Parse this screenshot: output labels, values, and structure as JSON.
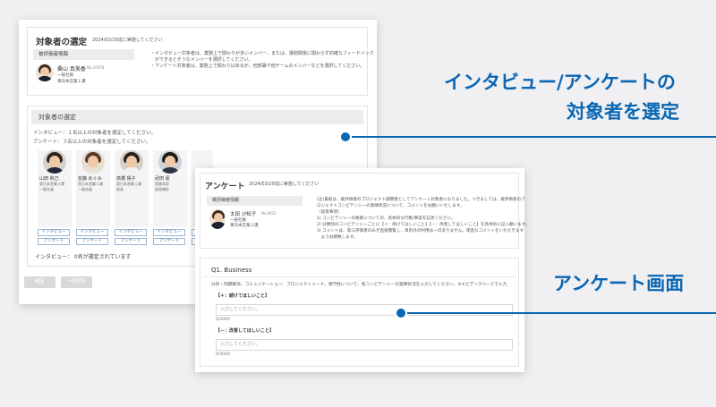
{
  "target_panel": {
    "title": "対象者の選定",
    "deadline": "2024/02/29迄に実施してください",
    "evaluatee_header": "被評価者情報",
    "evaluatee": {
      "name": "桑山 真美香",
      "id": "No.10078",
      "role": "一般社員",
      "dept": "東日本営業１課"
    },
    "instructions": [
      "・インタビュー対象者は、業務上で関わりが多いメンバー、または、援助関係に関わらず的確なフィードバック",
      "　ができるとそうなメンバーを選択してください。",
      "・アンケート対象者は、業務上で関わりはあるが、他部署や他チームのメンバーなどを選択してください。"
    ],
    "select_header": "対象者の選定",
    "interview_note": "インタビュー：１名以上の対象者を選定してください。",
    "survey_note": "アンケート：３名以上の対象者を選定してください。",
    "employees": [
      {
        "name": "山田 和己",
        "dept": "東日本営業２課",
        "role": "一般社員"
      },
      {
        "name": "佐藤 めぐみ",
        "dept": "西日本営業１課",
        "role": "一般社員"
      },
      {
        "name": "高橋 晴子",
        "dept": "東日本営業１課",
        "role": "係長"
      },
      {
        "name": "武田 豪",
        "dept": "営業本部",
        "role": "部長補佐"
      }
    ],
    "interview_btn": "インタビュー",
    "survey_btn": "アンケート",
    "selected_status": "インタビュー： 0名が選定されています",
    "confirm_btn": "確定",
    "save_btn": "一時保存"
  },
  "survey_panel": {
    "title": "アンケート",
    "deadline": "2024/03/29迄に実施してください",
    "evaluatee_header": "被評価者情報",
    "evaluatee": {
      "name": "太田 沙知子",
      "id": "No.0012",
      "role": "一般社員",
      "dept": "東日本営業２課"
    },
    "description": [
      "(注)貴殿は、被評価者のプロジェクト期間者としてアンケート対象者になりました。つきましては、被評価者のプ",
      "ロジェクトコンピテンシーの発揮状況について、コメントをお願いいたします。",
      "〈留意事項〉",
      "1) コンピテンシーの根拠についての、具体的な行動/事実を記述ください。",
      "2) 分類別のコンピテンシーごとに【＋：続けてほしいこと】【－：改善してほしいこと】を具体的に記入願います。",
      "3) コメントは、第三評価者のみが直接閲覧し、目的外の利用は一切ありません。率直なコメントをいただきます",
      "　ようお願致します。"
    ],
    "question_title": "Q1. Business",
    "question_desc": "分析・問題解決、コミュニケーション、プロジェクトリード、専門性について、各コンピテンシーの発揮状況を入力してください。※エビデンスベースで入力",
    "plus_label": "【＋：続けてほしいこと】",
    "plus_placeholder": "入力してください。",
    "plus_count": "0/3000",
    "minus_label": "【－：改善してほしいこと】",
    "minus_placeholder": "入力してください。",
    "minus_count": "0/3000"
  },
  "callouts": {
    "top_line1": "インタビュー/アンケートの",
    "top_line2": "対象者を選定",
    "bottom": "アンケート画面"
  },
  "colors": {
    "accent": "#0a66b3",
    "button_border": "#9bb6d3",
    "panel_bg": "#ffffff",
    "page_bg": "#f0f0f2"
  }
}
